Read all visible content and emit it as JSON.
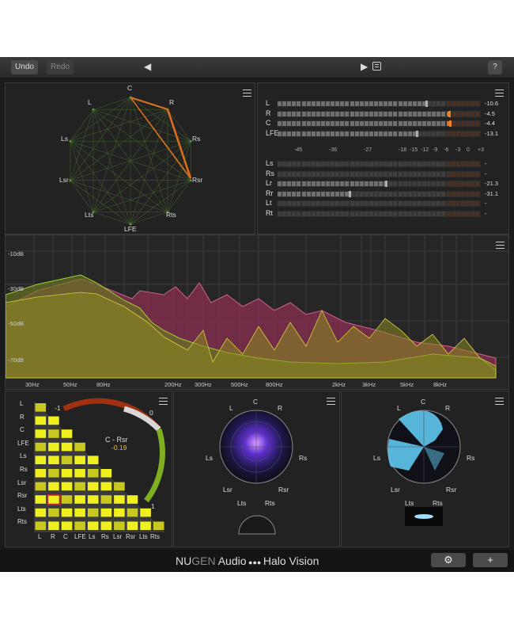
{
  "toolbar": {
    "undo": "Undo",
    "redo": "Redo",
    "help": "?"
  },
  "halo_top": {
    "labels": [
      "C",
      "R",
      "Rs",
      "Rsr",
      "Rts",
      "LFE",
      "Lts",
      "Lsr",
      "Ls",
      "L"
    ]
  },
  "meters": {
    "rows_top": [
      {
        "name": "L",
        "value": "-10.6"
      },
      {
        "name": "R",
        "value": "-4.5"
      },
      {
        "name": "C",
        "value": "-4.4"
      },
      {
        "name": "LFE",
        "value": "-13.1"
      }
    ],
    "scale": [
      "-45",
      "-36",
      "-27",
      "-18",
      "-15",
      "-12",
      "-9",
      "-6",
      "-3",
      "0",
      "+3"
    ],
    "rows_bottom": [
      {
        "name": "Ls",
        "value": "-"
      },
      {
        "name": "Rs",
        "value": "-"
      },
      {
        "name": "Lr",
        "value": "-21.3"
      },
      {
        "name": "Rr",
        "value": "-31.1"
      },
      {
        "name": "Lt",
        "value": "-"
      },
      {
        "name": "Rt",
        "value": "-"
      }
    ]
  },
  "spectrum": {
    "db_labels": [
      "-10dB",
      "-30dB",
      "-50dB",
      "-70dB"
    ],
    "freq_labels": [
      "30Hz",
      "50Hz",
      "80Hz",
      "200Hz",
      "300Hz",
      "500Hz",
      "800Hz",
      "2kHz",
      "3kHz",
      "5kHz",
      "8kHz"
    ]
  },
  "correlation": {
    "rows": [
      "L",
      "R",
      "C",
      "LFE",
      "Ls",
      "Rs",
      "Lsr",
      "Rsr",
      "Lts",
      "Rts"
    ],
    "cols": [
      "L",
      "R",
      "C",
      "LFE",
      "Ls",
      "Rs",
      "Lsr",
      "Rsr",
      "Lts",
      "Rts"
    ],
    "pair": "C - Rsr",
    "pair_value": "-0.19",
    "gauge_min": "-1",
    "gauge_mid": "0",
    "gauge_max": "1"
  },
  "halo_mid": {
    "labels": [
      "C",
      "L",
      "R",
      "Ls",
      "Rs",
      "Lsr",
      "Rsr",
      "Lts",
      "Rts"
    ]
  },
  "halo_right": {
    "labels": [
      "C",
      "L",
      "R",
      "Ls",
      "Rs",
      "Lsr",
      "Rsr",
      "Lts",
      "Rts"
    ]
  },
  "footer": {
    "brand_nu": "NU",
    "brand_gen": "GEN",
    "brand_audio": " Audio",
    "brand_dots": " ●●● ",
    "brand_product": "Halo Vision"
  },
  "colors": {
    "accent_orange": "#e07020",
    "yellow": "#f0f020",
    "green": "#80c020",
    "pink": "#c04070"
  }
}
